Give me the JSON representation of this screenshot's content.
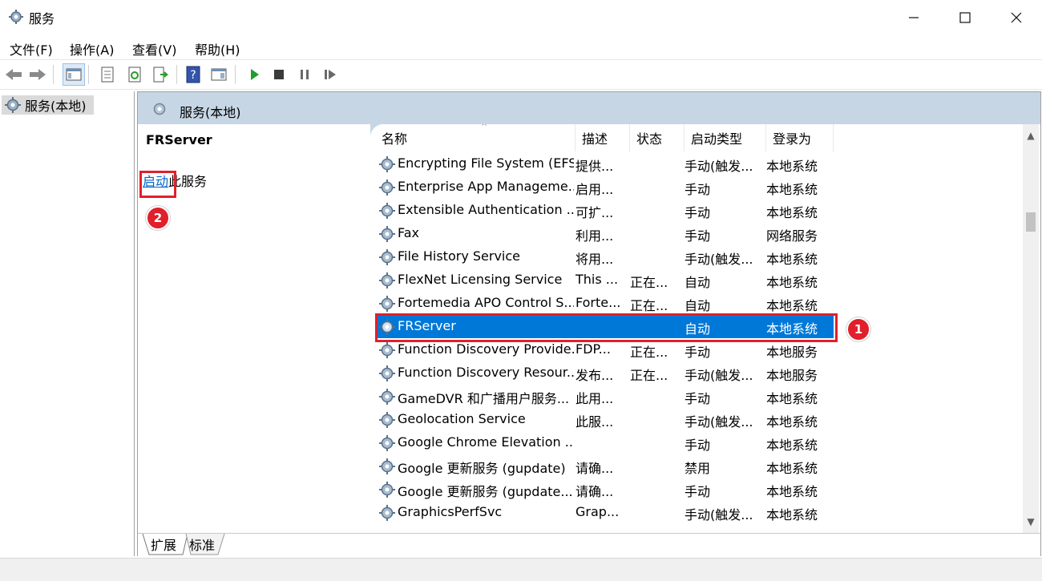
{
  "window": {
    "title": "服务",
    "minimize_icon": "minimize-icon",
    "maximize_icon": "maximize-icon",
    "close_icon": "close-icon"
  },
  "menu": [
    "文件(F)",
    "操作(A)",
    "查看(V)",
    "帮助(H)"
  ],
  "toolbar": [
    "back-arrow-icon",
    "forward-arrow-icon",
    "show-console-tree-icon",
    "properties-icon",
    "refresh-icon",
    "export-list-icon",
    "help-icon",
    "show-action-pane-icon",
    "start-service-icon",
    "stop-service-icon",
    "pause-service-icon",
    "restart-service-icon"
  ],
  "tree": {
    "root_label": "服务(本地)"
  },
  "main_header": {
    "label": "服务(本地)"
  },
  "description_pane": {
    "service_name": "FRServer",
    "link_text": "启动",
    "link_suffix": "此服务"
  },
  "annotations": {
    "badge_1": "1",
    "badge_2": "2",
    "highlight_color": "#e0202a"
  },
  "columns": [
    "名称",
    "描述",
    "状态",
    "启动类型",
    "登录为"
  ],
  "rows": [
    {
      "name": "Encrypting File System (EFS)",
      "desc": "提供...",
      "status": "",
      "startup": "手动(触发...",
      "logon": "本地系统"
    },
    {
      "name": "Enterprise App Manageme...",
      "desc": "启用...",
      "status": "",
      "startup": "手动",
      "logon": "本地系统"
    },
    {
      "name": "Extensible Authentication ...",
      "desc": "可扩...",
      "status": "",
      "startup": "手动",
      "logon": "本地系统"
    },
    {
      "name": "Fax",
      "desc": "利用...",
      "status": "",
      "startup": "手动",
      "logon": "网络服务"
    },
    {
      "name": "File History Service",
      "desc": "将用...",
      "status": "",
      "startup": "手动(触发...",
      "logon": "本地系统"
    },
    {
      "name": "FlexNet Licensing Service",
      "desc": "This ...",
      "status": "正在...",
      "startup": "自动",
      "logon": "本地系统"
    },
    {
      "name": "Fortemedia APO Control S...",
      "desc": "Forte...",
      "status": "正在...",
      "startup": "自动",
      "logon": "本地系统"
    },
    {
      "name": "FRServer",
      "desc": "",
      "status": "",
      "startup": "自动",
      "logon": "本地系统",
      "selected": true
    },
    {
      "name": "Function Discovery Provide...",
      "desc": "FDP...",
      "status": "正在...",
      "startup": "手动",
      "logon": "本地服务"
    },
    {
      "name": "Function Discovery Resour...",
      "desc": "发布...",
      "status": "正在...",
      "startup": "手动(触发...",
      "logon": "本地服务"
    },
    {
      "name": "GameDVR 和广播用户服务...",
      "desc": "此用...",
      "status": "",
      "startup": "手动",
      "logon": "本地系统"
    },
    {
      "name": "Geolocation Service",
      "desc": "此服...",
      "status": "",
      "startup": "手动(触发...",
      "logon": "本地系统"
    },
    {
      "name": "Google Chrome Elevation ...",
      "desc": "",
      "status": "",
      "startup": "手动",
      "logon": "本地系统"
    },
    {
      "name": "Google 更新服务 (gupdate)",
      "desc": "请确...",
      "status": "",
      "startup": "禁用",
      "logon": "本地系统"
    },
    {
      "name": "Google 更新服务 (gupdate...",
      "desc": "请确...",
      "status": "",
      "startup": "手动",
      "logon": "本地系统"
    },
    {
      "name": "GraphicsPerfSvc",
      "desc": "Grap...",
      "status": "",
      "startup": "手动(触发...",
      "logon": "本地系统"
    }
  ],
  "tabs": [
    "扩展",
    "标准"
  ],
  "colors": {
    "selection": "#0078d7",
    "header_band": "#c7d6e4",
    "link": "#0066cc"
  }
}
